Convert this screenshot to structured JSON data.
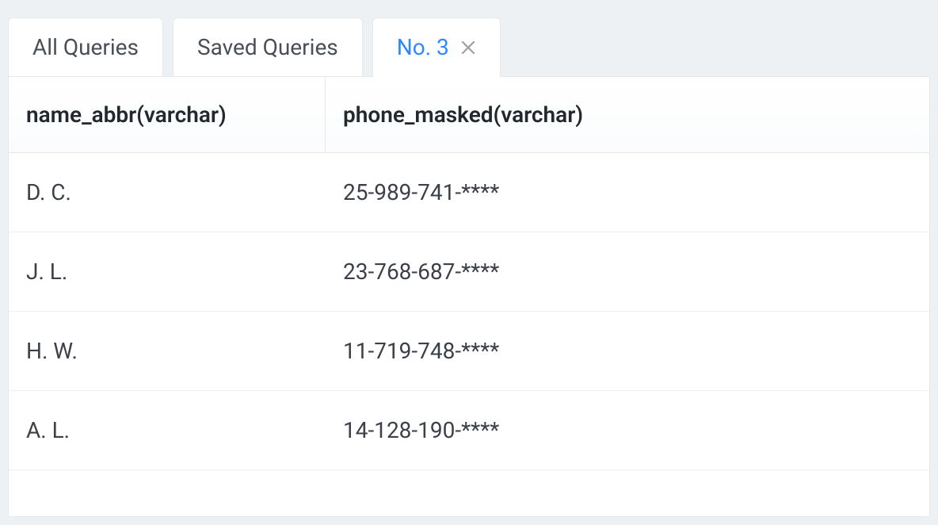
{
  "tabs": [
    {
      "label": "All Queries",
      "active": false,
      "closable": false
    },
    {
      "label": "Saved Queries",
      "active": false,
      "closable": false
    },
    {
      "label": "No. 3",
      "active": true,
      "closable": true
    }
  ],
  "columns": [
    {
      "header": "name_abbr(varchar)"
    },
    {
      "header": "phone_masked(varchar)"
    }
  ],
  "rows": [
    {
      "name_abbr": "D. C.",
      "phone_masked": "25-989-741-****"
    },
    {
      "name_abbr": "J. L.",
      "phone_masked": "23-768-687-****"
    },
    {
      "name_abbr": "H. W.",
      "phone_masked": "11-719-748-****"
    },
    {
      "name_abbr": "A. L.",
      "phone_masked": "14-128-190-****"
    }
  ]
}
